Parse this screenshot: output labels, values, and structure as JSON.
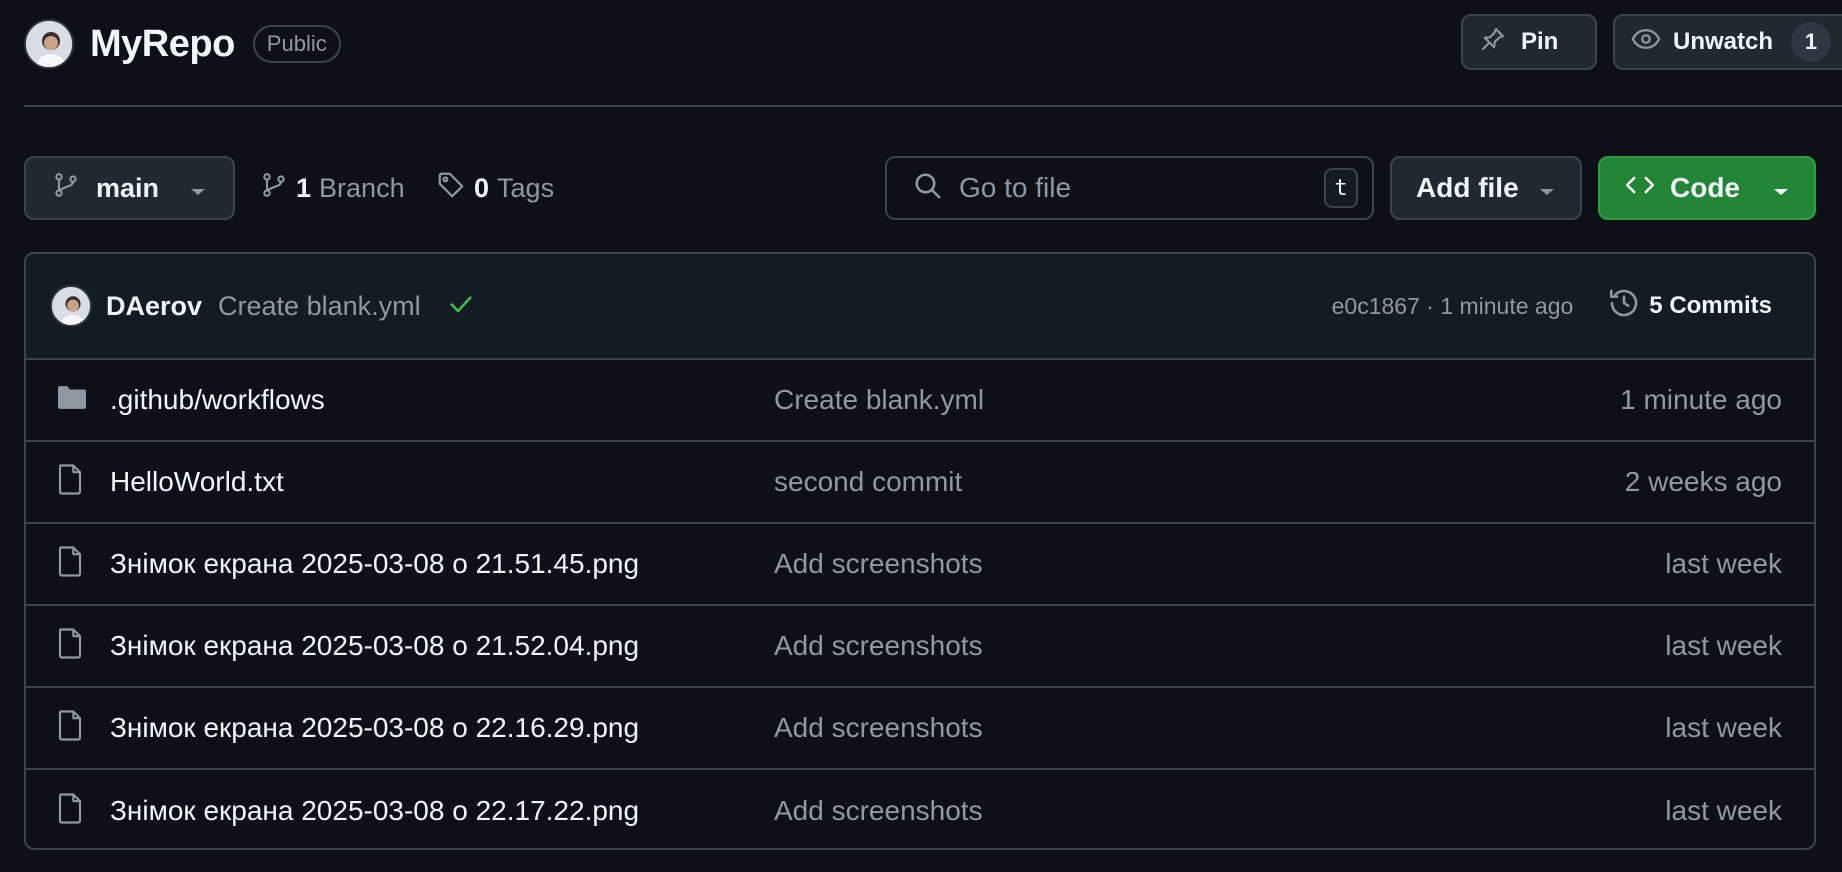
{
  "repo": {
    "name": "MyRepo",
    "visibility": "Public",
    "pin_label": "Pin",
    "watch_label": "Unwatch",
    "watch_count": "1"
  },
  "toolbar": {
    "branch": "main",
    "branch_count": "1",
    "branch_word": "Branch",
    "tag_count": "0",
    "tag_word": "Tags",
    "search_placeholder": "Go to file",
    "search_shortcut": "t",
    "add_file_label": "Add file",
    "code_label": "Code"
  },
  "latest_commit": {
    "author": "DAerov",
    "message": "Create blank.yml",
    "status": "success",
    "meta": "e0c1867 · 1 minute ago",
    "commits_label": "5 Commits"
  },
  "files": [
    {
      "type": "dir",
      "name": ".github/workflows",
      "commit": "Create blank.yml",
      "age": "1 minute ago"
    },
    {
      "type": "file",
      "name": "HelloWorld.txt",
      "commit": "second commit",
      "age": "2 weeks ago"
    },
    {
      "type": "file",
      "name": "Знімок екрана 2025-03-08 о 21.51.45.png",
      "commit": "Add screenshots",
      "age": "last week"
    },
    {
      "type": "file",
      "name": "Знімок екрана 2025-03-08 о 21.52.04.png",
      "commit": "Add screenshots",
      "age": "last week"
    },
    {
      "type": "file",
      "name": "Знімок екрана 2025-03-08 о 22.16.29.png",
      "commit": "Add screenshots",
      "age": "last week"
    },
    {
      "type": "file",
      "name": "Знімок екрана 2025-03-08 о 22.17.22.png",
      "commit": "Add screenshots",
      "age": "last week"
    }
  ],
  "colors": {
    "background": "#0d1117",
    "border": "#3d444d",
    "code_button": "#238636",
    "success": "#3fb950",
    "muted_text": "#9198a1"
  }
}
